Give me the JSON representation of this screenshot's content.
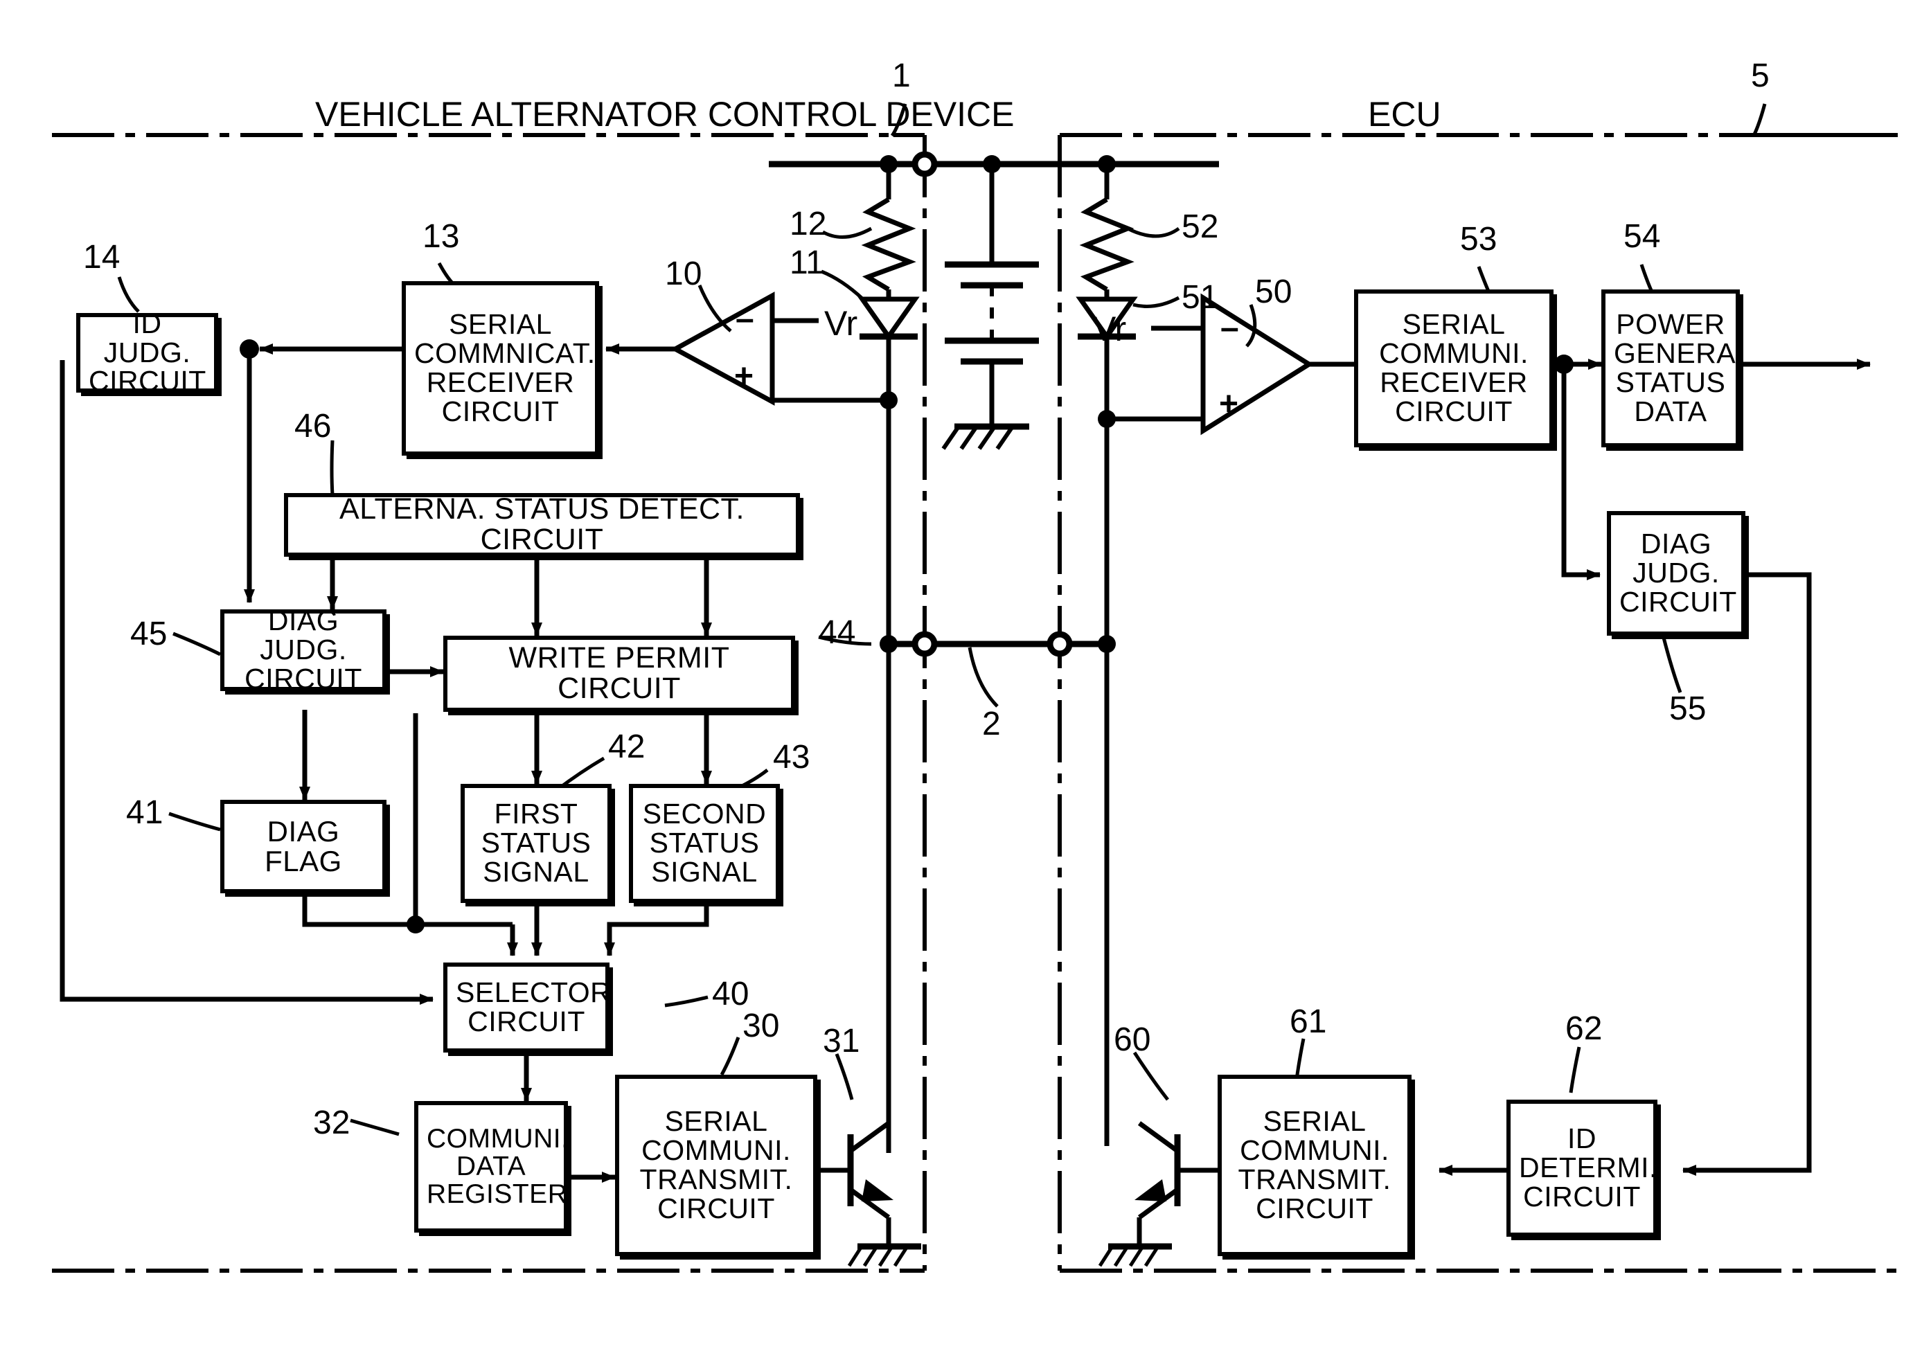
{
  "figure": {
    "left_region_title": "VEHICLE ALTERNATOR CONTROL DEVICE",
    "left_region_ref": "1",
    "right_region_title": "ECU",
    "right_region_ref": "5",
    "bus_ref": "2"
  },
  "signals": {
    "vr_left": "Vr",
    "vr_right": "Vr",
    "comparator_minus": "–",
    "comparator_plus": "+"
  },
  "alternator_side": {
    "blocks": [
      {
        "id": "id-judg-circuit",
        "ref": "14",
        "lines": [
          "ID JUDG.",
          "CIRCUIT"
        ]
      },
      {
        "id": "serial-commnicat-receiver",
        "ref": "13",
        "lines": [
          "SERIAL",
          "COMMNICAT.",
          "RECEIVER",
          "CIRCUIT"
        ]
      },
      {
        "id": "alterna-status-detect",
        "ref": "46",
        "lines": [
          "ALTERNA. STATUS DETECT. CIRCUIT"
        ]
      },
      {
        "id": "diag-judg-circuit",
        "ref": "45",
        "lines": [
          "DIAG JUDG.",
          "CIRCUIT"
        ]
      },
      {
        "id": "write-permit-circuit",
        "ref": "44",
        "lines": [
          "WRITE PERMIT CIRCUIT"
        ]
      },
      {
        "id": "diag-flag",
        "ref": "41",
        "lines": [
          "DIAG FLAG"
        ]
      },
      {
        "id": "first-status-signal",
        "ref": "42",
        "lines": [
          "FIRST",
          "STATUS",
          "SIGNAL"
        ]
      },
      {
        "id": "second-status-signal",
        "ref": "43",
        "lines": [
          "SECOND",
          "STATUS",
          "SIGNAL"
        ]
      },
      {
        "id": "selector-circuit",
        "ref": "40",
        "lines": [
          "SELECTOR",
          "CIRCUIT"
        ]
      },
      {
        "id": "communi-data-register",
        "ref": "32",
        "lines": [
          "COMMUNI.",
          "DATA",
          "REGISTER"
        ]
      },
      {
        "id": "serial-communi-transmit",
        "ref": "30",
        "lines": [
          "SERIAL",
          "COMMUNI.",
          "TRANSMIT.",
          "CIRCUIT"
        ]
      }
    ],
    "components": [
      {
        "id": "comparator",
        "ref": "10"
      },
      {
        "id": "diode",
        "ref": "11"
      },
      {
        "id": "resistor",
        "ref": "12"
      },
      {
        "id": "transistor",
        "ref": "31"
      }
    ]
  },
  "ecu_side": {
    "blocks": [
      {
        "id": "serial-communi-receiver",
        "ref": "53",
        "lines": [
          "SERIAL",
          "COMMUNI.",
          "RECEIVER",
          "CIRCUIT"
        ]
      },
      {
        "id": "power-genera-status-data",
        "ref": "54",
        "lines": [
          "POWER",
          "GENERA.",
          "STATUS",
          "DATA"
        ]
      },
      {
        "id": "diag-judg-circuit-ecu",
        "ref": "55",
        "lines": [
          "DIAG",
          "JUDG.",
          "CIRCUIT"
        ]
      },
      {
        "id": "serial-communi-transmit-ecu",
        "ref": "61",
        "lines": [
          "SERIAL",
          "COMMUNI.",
          "TRANSMIT.",
          "CIRCUIT"
        ]
      },
      {
        "id": "id-determi-circuit",
        "ref": "62",
        "lines": [
          "ID",
          "DETERMI.",
          "CIRCUIT"
        ]
      }
    ],
    "components": [
      {
        "id": "comparator-ecu",
        "ref": "50"
      },
      {
        "id": "diode-ecu",
        "ref": "51"
      },
      {
        "id": "resistor-ecu",
        "ref": "52"
      },
      {
        "id": "transistor-ecu",
        "ref": "60"
      }
    ]
  }
}
